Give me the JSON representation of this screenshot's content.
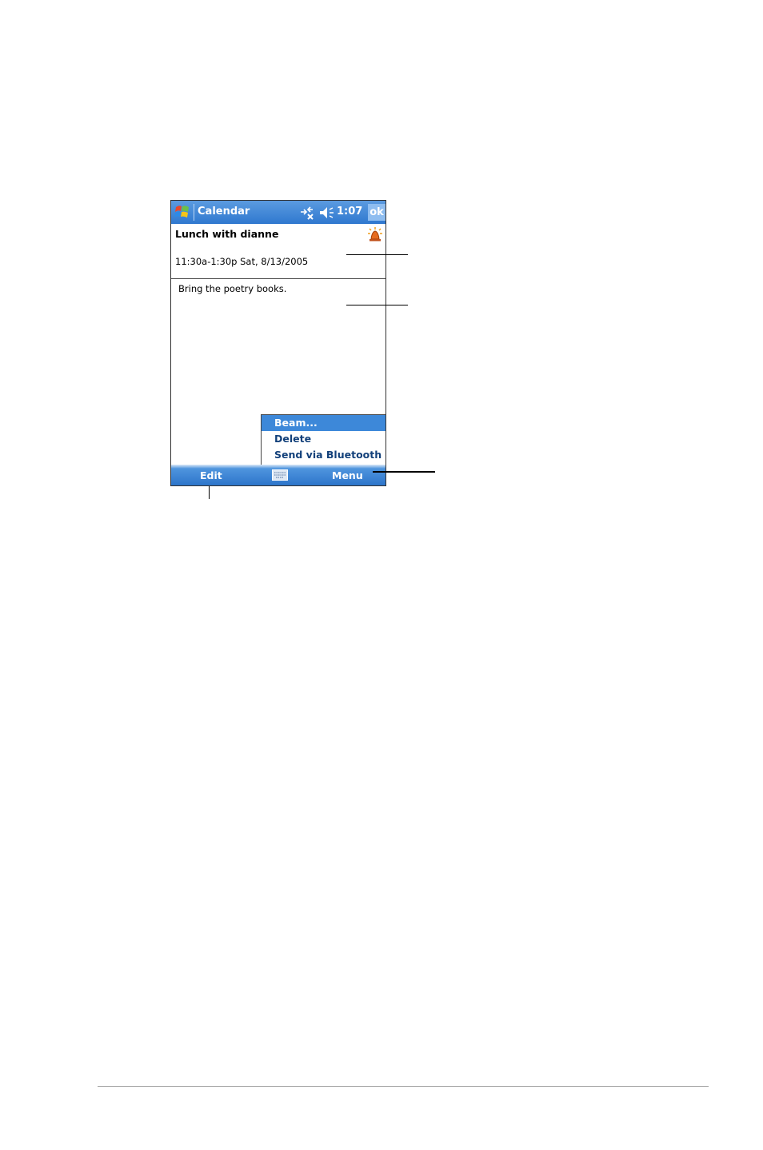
{
  "window": {
    "title": "Calendar",
    "clock": "1:07",
    "ok_label": "ok"
  },
  "appointment": {
    "subject": "Lunch with dianne",
    "when": "11:30a-1:30p Sat, 8/13/2005",
    "note": "Bring the poetry books."
  },
  "popup_menu": {
    "items": [
      {
        "label": "Beam...",
        "selected": true
      },
      {
        "label": "Delete",
        "selected": false
      },
      {
        "label": "Send via Bluetooth",
        "selected": false
      }
    ]
  },
  "command_bar": {
    "left_label": "Edit",
    "right_label": "Menu",
    "keyboard_icon": "keyboard-icon"
  },
  "icons": {
    "start": "windows-flag-icon",
    "connectivity": "connectivity-icon",
    "volume": "speaker-muted-icon",
    "reminder": "reminder-bell-icon"
  },
  "colors": {
    "titlebar": "#2f78cf",
    "selection": "#3d88d9",
    "menu_text": "#12407a"
  }
}
